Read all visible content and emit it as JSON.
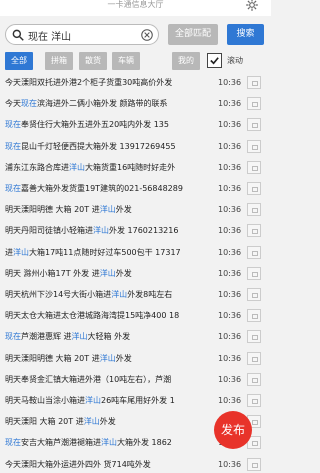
{
  "header": {
    "title": "一卡通信息大厅"
  },
  "search": {
    "value": "现在 洋山",
    "all_label": "全部匹配",
    "search_label": "搜索"
  },
  "filters": [
    {
      "label": "全部",
      "active": true
    },
    {
      "label": "拼箱",
      "active": false
    },
    {
      "label": "散货",
      "active": false
    },
    {
      "label": "车辆",
      "active": false
    },
    {
      "label": "我的",
      "active": false
    }
  ],
  "scroll": {
    "label": "滚动",
    "checked": true
  },
  "list": [
    {
      "parts": [
        "今天溧阳双托进外港2个柜子货重30吨高价外发"
      ],
      "time": "10:36"
    },
    {
      "parts": [
        "今天",
        "现在",
        "滨海进外二俩小箱外发 颜路带的联系"
      ],
      "time": "10:36"
    },
    {
      "parts": [
        "现在",
        "奉贤住行大箱外五进外五20吨内外发 135"
      ],
      "time": "10:36"
    },
    {
      "parts": [
        "现在",
        "昆山千灯轻便西提大箱外发 13917269455"
      ],
      "time": "10:36"
    },
    {
      "parts": [
        "浦东江东路合库进",
        "洋山",
        "大箱货重16吨随时好走外"
      ],
      "time": "10:36"
    },
    {
      "parts": [
        "现在",
        "嘉善大箱外发货重19T建筑的021-56848289"
      ],
      "time": "10:36"
    },
    {
      "parts": [
        "明天溧阳明德 大箱 20T 进",
        "洋山",
        "外发"
      ],
      "time": "10:36"
    },
    {
      "parts": [
        "明天丹阳司徒镇小轻箱进",
        "洋山",
        "外发 1760213216"
      ],
      "time": "10:36"
    },
    {
      "parts": [
        "进",
        "洋山",
        "大箱17吨11点随时好过车500包干 17317"
      ],
      "time": "10:36"
    },
    {
      "parts": [
        "明天 滁州小箱17T 外发 进",
        "洋山",
        "外发"
      ],
      "time": "10:36"
    },
    {
      "parts": [
        "明天杭州下沙14号大街小箱进",
        "洋山",
        "外发8吨左右"
      ],
      "time": "10:36"
    },
    {
      "parts": [
        "明天太仓大箱进太仓港城路海湾提15吨净400 18"
      ],
      "time": "10:36"
    },
    {
      "parts": [
        "现在",
        "芦潮港惠辉 进",
        "洋山",
        "大轻箱 外发"
      ],
      "time": "10:36"
    },
    {
      "parts": [
        "明天溧阳明德 大箱 20T 进",
        "洋山",
        "外发"
      ],
      "time": "10:36"
    },
    {
      "parts": [
        "明天奉贤金汇镇大箱进外港（10吨左右），芦潮"
      ],
      "time": "10:36"
    },
    {
      "parts": [
        "明天马鞍山当涂小箱进",
        "洋山",
        "26吨车尾用好外发 1"
      ],
      "time": "10:36"
    },
    {
      "parts": [
        "明天溧阳 大箱 20T 进",
        "洋山",
        "外发"
      ],
      "time": "10:36"
    },
    {
      "parts": [
        "现在",
        "安吉大箱芦潮港褪箱进",
        "洋山",
        "大箱外发 1862"
      ],
      "time": "10:36"
    },
    {
      "parts": [
        "今天溧阳大箱外运进外四外 货714吨外发"
      ],
      "time": "10:36"
    }
  ],
  "fab": {
    "label": "发布"
  }
}
